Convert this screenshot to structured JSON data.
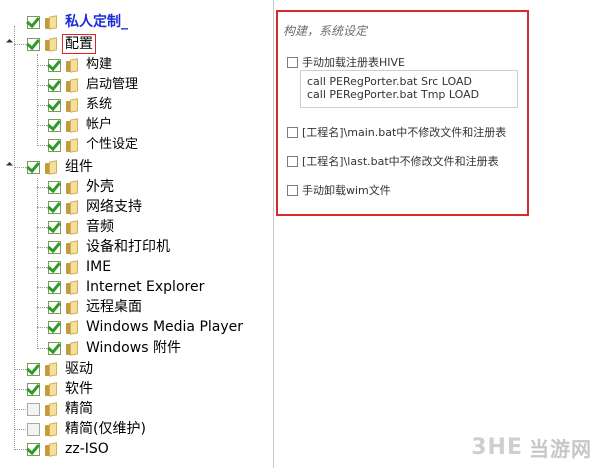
{
  "tree": {
    "items": [
      {
        "label": "私人定制_",
        "checked": true,
        "style": "blue"
      },
      {
        "label": "配置",
        "checked": true,
        "style": "selected"
      },
      {
        "label": "构建",
        "checked": true
      },
      {
        "label": "启动管理",
        "checked": true
      },
      {
        "label": "系统",
        "checked": true
      },
      {
        "label": "帐户",
        "checked": true
      },
      {
        "label": "个性设定",
        "checked": true
      },
      {
        "label": "组件",
        "checked": true
      },
      {
        "label": "外壳",
        "checked": true
      },
      {
        "label": "网络支持",
        "checked": true
      },
      {
        "label": "音频",
        "checked": true
      },
      {
        "label": "设备和打印机",
        "checked": true
      },
      {
        "label": "IME",
        "checked": true
      },
      {
        "label": "Internet Explorer",
        "checked": true
      },
      {
        "label": "远程桌面",
        "checked": true
      },
      {
        "label": "Windows Media Player",
        "checked": true
      },
      {
        "label": "Windows 附件",
        "checked": true
      },
      {
        "label": "驱动",
        "checked": true
      },
      {
        "label": "软件",
        "checked": true
      },
      {
        "label": "精简",
        "checked": false
      },
      {
        "label": "精简(仅维护)",
        "checked": false
      },
      {
        "label": "zz-ISO",
        "checked": true
      }
    ]
  },
  "panel": {
    "title": "构建，系统设定",
    "options": [
      {
        "label": "手动加载注册表HIVE"
      },
      {
        "label": "[工程名]\\main.bat中不修改文件和注册表"
      },
      {
        "label": "[工程名]\\last.bat中不修改文件和注册表"
      },
      {
        "label": "手动卸载wim文件"
      }
    ],
    "code": {
      "line1": "call PERegPorter.bat Src LOAD",
      "line2": "call PERegPorter.bat Tmp LOAD"
    }
  },
  "watermark": {
    "logo": "3HE",
    "text": "当游网"
  },
  "colors": {
    "highlight_border": "#d8292b",
    "root_label": "#1c2bd8",
    "check": "#2f9a2a"
  }
}
